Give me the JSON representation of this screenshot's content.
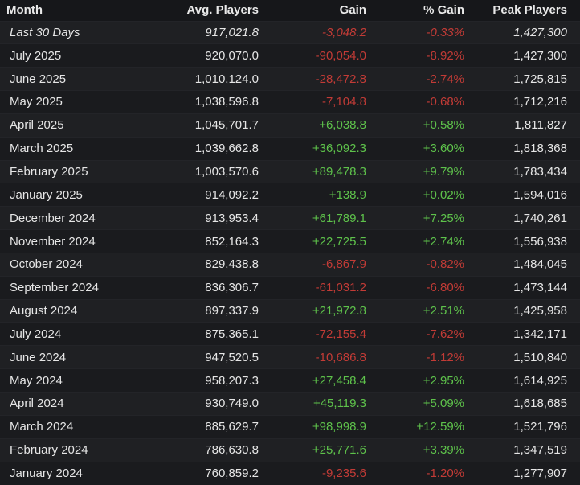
{
  "headers": {
    "month": "Month",
    "avg": "Avg. Players",
    "gain": "Gain",
    "pct": "% Gain",
    "peak": "Peak Players"
  },
  "colors": {
    "positive": "#5ec24b",
    "negative": "#c23b36"
  },
  "rows": [
    {
      "month": "Last 30 Days",
      "avg": "917,021.8",
      "gain": "-3,048.2",
      "pct": "-0.33%",
      "peak": "1,427,300",
      "sign": "neg",
      "italic": true
    },
    {
      "month": "July 2025",
      "avg": "920,070.0",
      "gain": "-90,054.0",
      "pct": "-8.92%",
      "peak": "1,427,300",
      "sign": "neg"
    },
    {
      "month": "June 2025",
      "avg": "1,010,124.0",
      "gain": "-28,472.8",
      "pct": "-2.74%",
      "peak": "1,725,815",
      "sign": "neg"
    },
    {
      "month": "May 2025",
      "avg": "1,038,596.8",
      "gain": "-7,104.8",
      "pct": "-0.68%",
      "peak": "1,712,216",
      "sign": "neg"
    },
    {
      "month": "April 2025",
      "avg": "1,045,701.7",
      "gain": "+6,038.8",
      "pct": "+0.58%",
      "peak": "1,811,827",
      "sign": "pos"
    },
    {
      "month": "March 2025",
      "avg": "1,039,662.8",
      "gain": "+36,092.3",
      "pct": "+3.60%",
      "peak": "1,818,368",
      "sign": "pos"
    },
    {
      "month": "February 2025",
      "avg": "1,003,570.6",
      "gain": "+89,478.3",
      "pct": "+9.79%",
      "peak": "1,783,434",
      "sign": "pos"
    },
    {
      "month": "January 2025",
      "avg": "914,092.2",
      "gain": "+138.9",
      "pct": "+0.02%",
      "peak": "1,594,016",
      "sign": "pos"
    },
    {
      "month": "December 2024",
      "avg": "913,953.4",
      "gain": "+61,789.1",
      "pct": "+7.25%",
      "peak": "1,740,261",
      "sign": "pos"
    },
    {
      "month": "November 2024",
      "avg": "852,164.3",
      "gain": "+22,725.5",
      "pct": "+2.74%",
      "peak": "1,556,938",
      "sign": "pos"
    },
    {
      "month": "October 2024",
      "avg": "829,438.8",
      "gain": "-6,867.9",
      "pct": "-0.82%",
      "peak": "1,484,045",
      "sign": "neg"
    },
    {
      "month": "September 2024",
      "avg": "836,306.7",
      "gain": "-61,031.2",
      "pct": "-6.80%",
      "peak": "1,473,144",
      "sign": "neg"
    },
    {
      "month": "August 2024",
      "avg": "897,337.9",
      "gain": "+21,972.8",
      "pct": "+2.51%",
      "peak": "1,425,958",
      "sign": "pos"
    },
    {
      "month": "July 2024",
      "avg": "875,365.1",
      "gain": "-72,155.4",
      "pct": "-7.62%",
      "peak": "1,342,171",
      "sign": "neg"
    },
    {
      "month": "June 2024",
      "avg": "947,520.5",
      "gain": "-10,686.8",
      "pct": "-1.12%",
      "peak": "1,510,840",
      "sign": "neg"
    },
    {
      "month": "May 2024",
      "avg": "958,207.3",
      "gain": "+27,458.4",
      "pct": "+2.95%",
      "peak": "1,614,925",
      "sign": "pos"
    },
    {
      "month": "April 2024",
      "avg": "930,749.0",
      "gain": "+45,119.3",
      "pct": "+5.09%",
      "peak": "1,618,685",
      "sign": "pos"
    },
    {
      "month": "March 2024",
      "avg": "885,629.7",
      "gain": "+98,998.9",
      "pct": "+12.59%",
      "peak": "1,521,796",
      "sign": "pos"
    },
    {
      "month": "February 2024",
      "avg": "786,630.8",
      "gain": "+25,771.6",
      "pct": "+3.39%",
      "peak": "1,347,519",
      "sign": "pos"
    },
    {
      "month": "January 2024",
      "avg": "760,859.2",
      "gain": "-9,235.6",
      "pct": "-1.20%",
      "peak": "1,277,907",
      "sign": "neg"
    }
  ]
}
